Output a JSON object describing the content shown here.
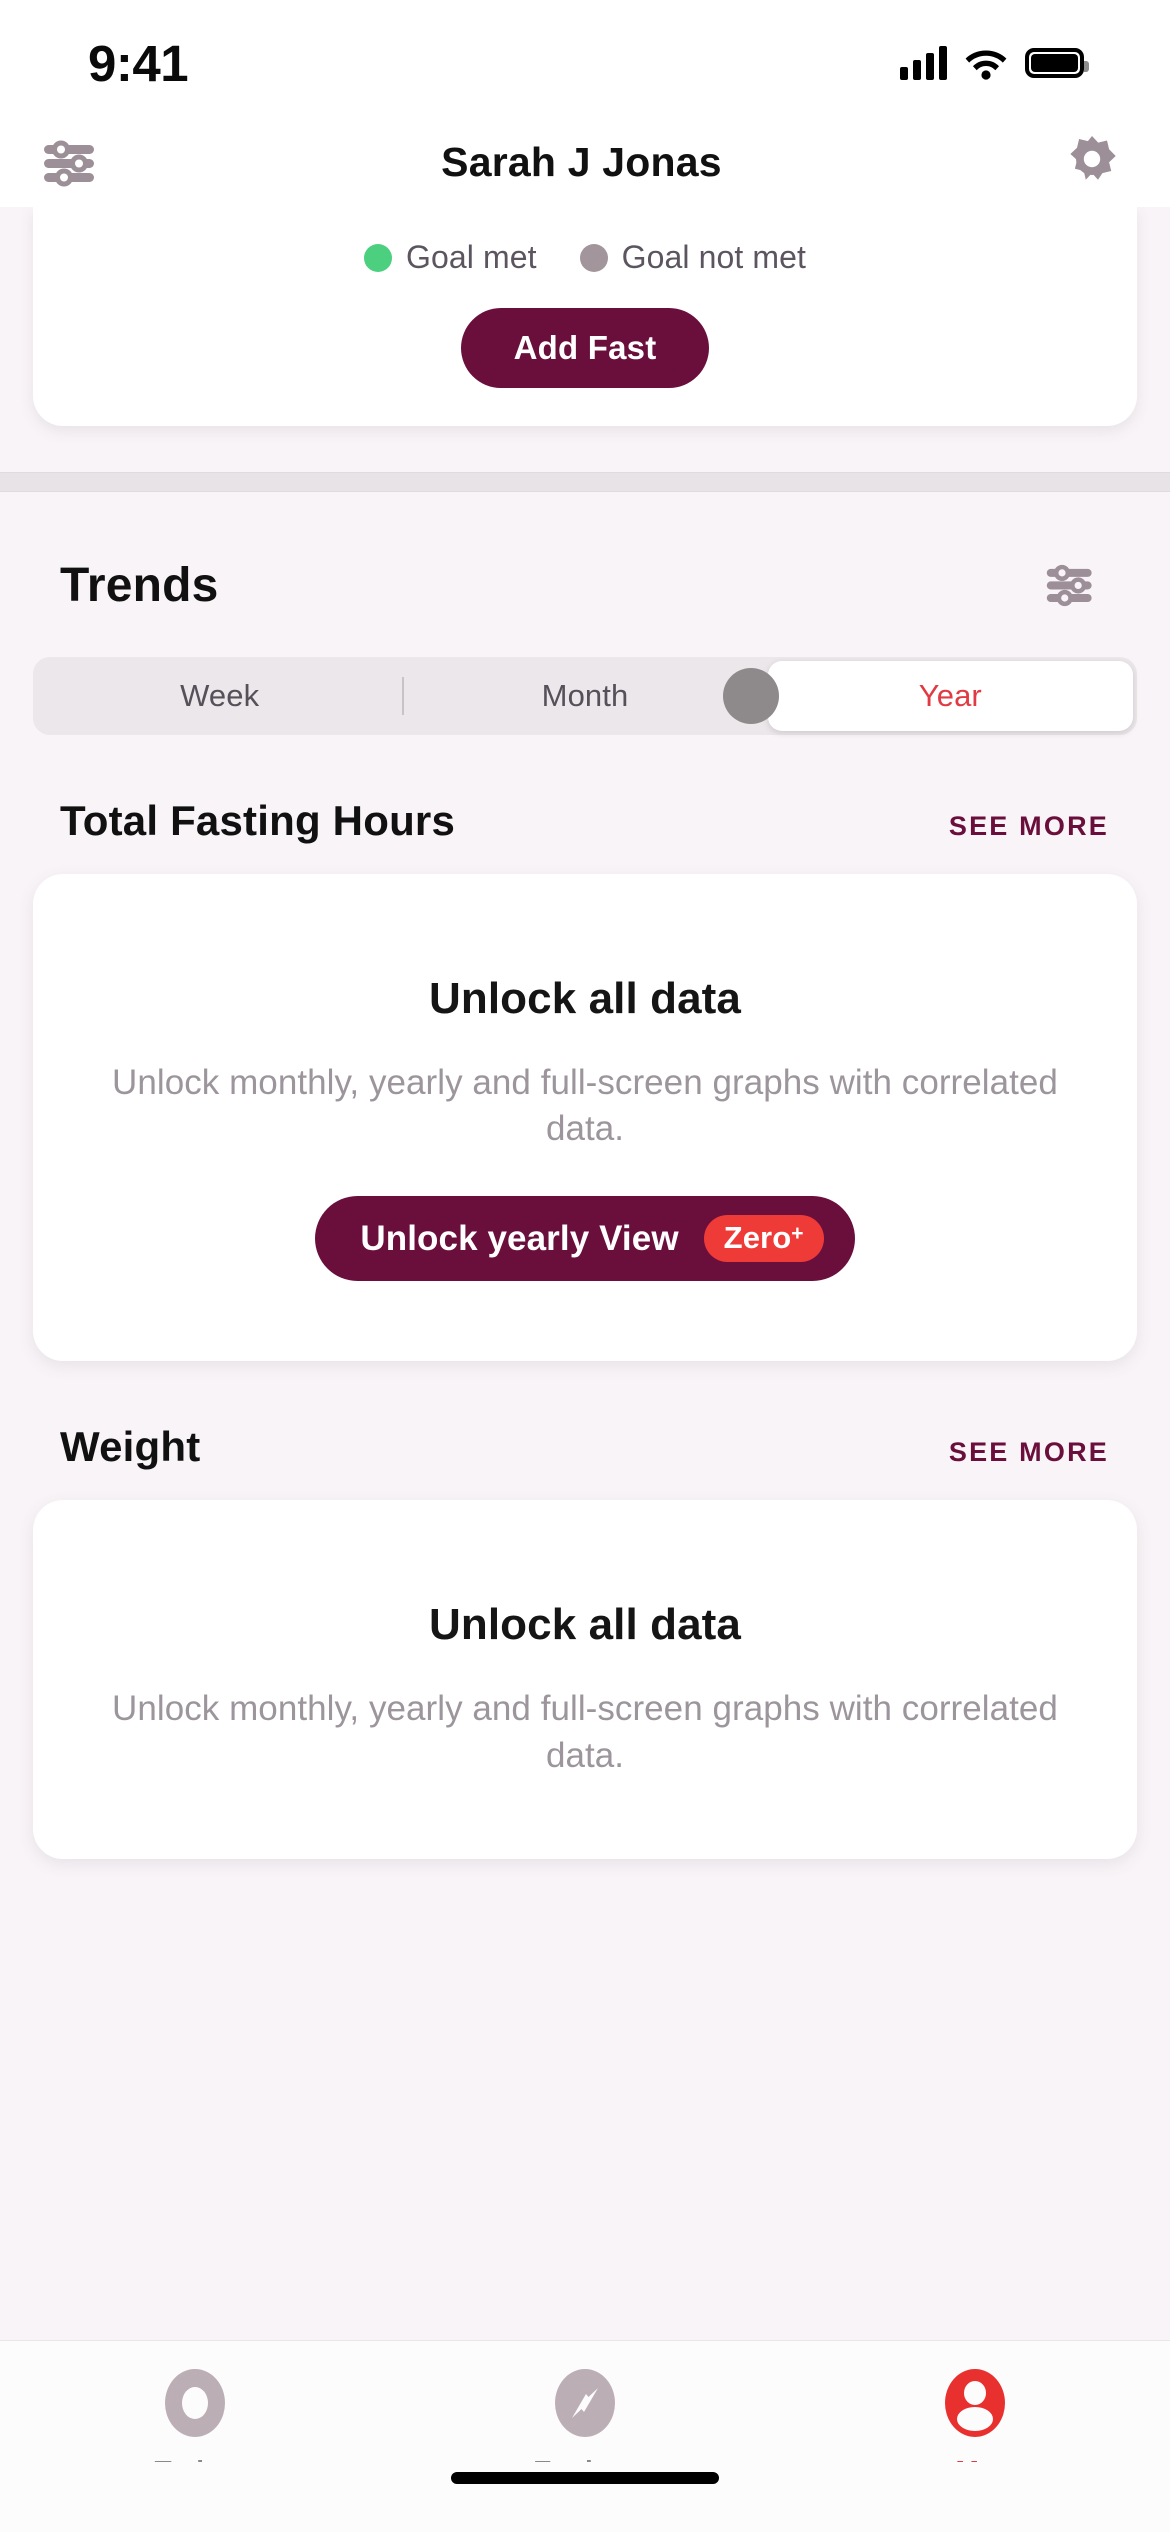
{
  "status_bar": {
    "time": "9:41",
    "cellular_icon": "signal-bars-icon",
    "wifi_icon": "wifi-icon",
    "battery_icon": "battery-icon"
  },
  "header": {
    "left_icon": "sliders-icon",
    "title": "Sarah J Jonas",
    "right_icon": "gear-icon"
  },
  "top_card": {
    "legend": [
      {
        "label": "Goal met",
        "color": "#4cd080"
      },
      {
        "label": "Goal not met",
        "color": "#a3959c"
      }
    ],
    "add_fast_label": "Add Fast"
  },
  "trends": {
    "title": "Trends",
    "filter_icon": "sliders-icon",
    "segments": [
      {
        "label": "Week",
        "selected": false
      },
      {
        "label": "Month",
        "selected": false
      },
      {
        "label": "Year",
        "selected": true
      }
    ]
  },
  "sections": [
    {
      "title": "Total Fasting Hours",
      "see_more": "SEE MORE",
      "card": {
        "heading": "Unlock all data",
        "body": "Unlock monthly, yearly and full-screen graphs with correlated data.",
        "button_label": "Unlock yearly View",
        "badge_text": "Zero",
        "badge_sup": "+"
      }
    },
    {
      "title": "Weight",
      "see_more": "SEE MORE",
      "card": {
        "heading": "Unlock all data",
        "body": "Unlock monthly, yearly and full-screen graphs with correlated data."
      }
    }
  ],
  "tab_bar": [
    {
      "label": "Today",
      "icon": "ring-icon",
      "active": false
    },
    {
      "label": "Explore",
      "icon": "compass-icon",
      "active": false
    },
    {
      "label": "Me",
      "icon": "person-icon",
      "active": true
    }
  ],
  "colors": {
    "brand_maroon": "#6a0f3c",
    "accent_red": "#e03b43",
    "badge_red": "#ef3b37",
    "page_bg": "#f8f4f7",
    "card_bg": "#ffffff",
    "muted_text": "#9c969c"
  }
}
